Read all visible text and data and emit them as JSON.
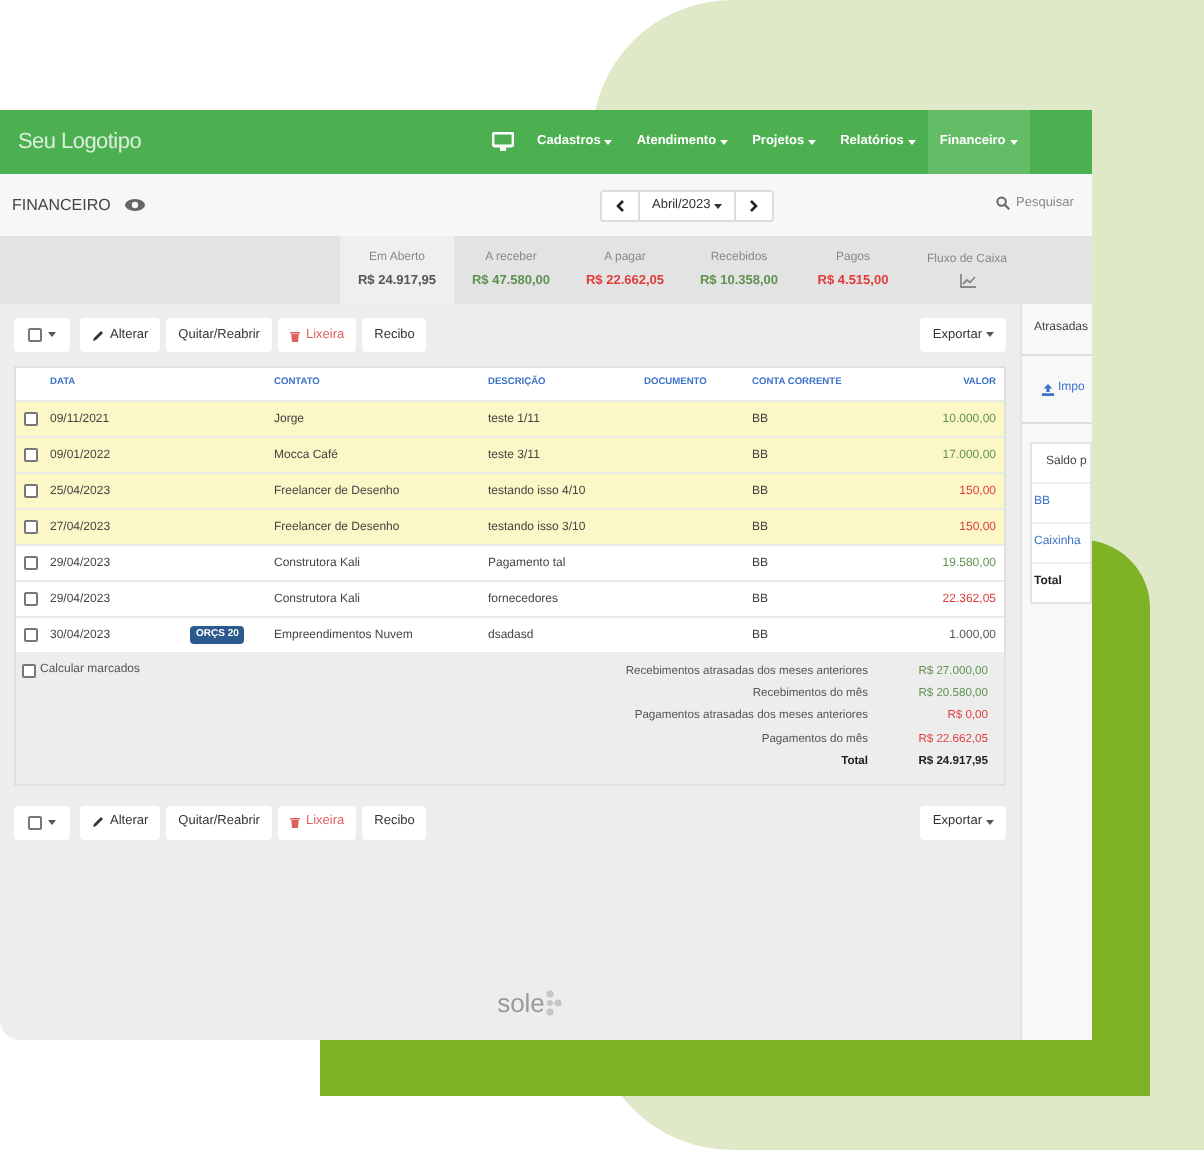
{
  "logo": "Seu Logotipo",
  "nav": [
    {
      "label": "Cadastros",
      "selected": false
    },
    {
      "label": "Atendimento",
      "selected": false
    },
    {
      "label": "Projetos",
      "selected": false
    },
    {
      "label": "Relatórios",
      "selected": false
    },
    {
      "label": "Financeiro",
      "selected": true
    }
  ],
  "page_title": "FINANCEIRO",
  "period": "Abril/2023",
  "search": {
    "placeholder": "Pesquisar"
  },
  "summary": [
    {
      "label": "Em Aberto",
      "value": "R$ 24.917,95",
      "color": "#555555",
      "selected": true
    },
    {
      "label": "A receber",
      "value": "R$ 47.580,00",
      "color": "#5f9150",
      "selected": false
    },
    {
      "label": "A pagar",
      "value": "R$ 22.662,05",
      "color": "#e03c3c",
      "selected": false
    },
    {
      "label": "Recebidos",
      "value": "R$ 10.358,00",
      "color": "#5f9150",
      "selected": false
    },
    {
      "label": "Pagos",
      "value": "R$ 4.515,00",
      "color": "#e03c3c",
      "selected": false
    },
    {
      "label": "Fluxo de Caixa",
      "kind": "chart",
      "selected": false
    }
  ],
  "toolbars": [
    {
      "buttons": [
        {
          "label": "Alterar",
          "kind": "edit"
        },
        {
          "label": "Quitar/Reabrir",
          "kind": "plain"
        },
        {
          "label": "Lixeira",
          "kind": "danger"
        },
        {
          "label": "Recibo",
          "kind": "plain"
        }
      ],
      "export": "Exportar"
    },
    {
      "buttons": [
        {
          "label": "Alterar",
          "kind": "edit"
        },
        {
          "label": "Quitar/Reabrir",
          "kind": "plain"
        },
        {
          "label": "Lixeira",
          "kind": "danger"
        },
        {
          "label": "Recibo",
          "kind": "plain"
        }
      ],
      "export": "Exportar"
    }
  ],
  "table": {
    "columns": [
      "DATA",
      "CONTATO",
      "DESCRIÇÃO",
      "DOCUMENTO",
      "CONTA CORRENTE",
      "VALOR"
    ],
    "rows": [
      {
        "date": "09/11/2021",
        "contact": "Jorge",
        "description": "teste 1/11",
        "account": "BB",
        "value": "10.000,00",
        "color": "#5f9150",
        "overdue": true,
        "checked": false
      },
      {
        "date": "09/01/2022",
        "contact": "Mocca Café",
        "description": "teste 3/11",
        "account": "BB",
        "value": "17.000,00",
        "color": "#5f9150",
        "overdue": true,
        "checked": false
      },
      {
        "date": "25/04/2023",
        "contact": "Freelancer de Desenho",
        "description": "testando isso 4/10",
        "account": "BB",
        "value": "150,00",
        "color": "#e03c3c",
        "overdue": true,
        "checked": false
      },
      {
        "date": "27/04/2023",
        "contact": "Freelancer de Desenho",
        "description": "testando isso 3/10",
        "account": "BB",
        "value": "150,00",
        "color": "#e03c3c",
        "overdue": true,
        "checked": false
      },
      {
        "date": "29/04/2023",
        "contact": "Construtora Kali",
        "description": "Pagamento tal",
        "account": "BB",
        "value": "19.580,00",
        "color": "#5f9150",
        "overdue": false,
        "checked": false
      },
      {
        "date": "29/04/2023",
        "contact": "Construtora Kali",
        "description": "fornecedores",
        "account": "BB",
        "value": "22.362,05",
        "color": "#e03c3c",
        "overdue": false,
        "checked": false
      },
      {
        "date": "30/04/2023",
        "badge": "ORÇS 20",
        "contact": "Empreendimentos Nuvem",
        "description": "dsadasd",
        "account": "BB",
        "value": "1.000,00",
        "color": "#555555",
        "overdue": false,
        "checked": false
      }
    ]
  },
  "calc_marked": {
    "label": "Calcular marcados",
    "checked": false
  },
  "totals": [
    {
      "label": "Recebimentos atrasadas dos meses anteriores",
      "value": "R$ 27.000,00",
      "color": "#5f9150",
      "kind": "line"
    },
    {
      "label": "Recebimentos do mês",
      "value": "R$ 20.580,00",
      "color": "#5f9150",
      "kind": "line"
    },
    {
      "label": "Pagamentos atrasadas dos meses anteriores",
      "value": "R$ 0,00",
      "color": "#e03c3c",
      "kind": "line"
    },
    {
      "label": "Pagamentos do mês",
      "value": "R$ 22.662,05",
      "color": "#e03c3c",
      "kind": "line"
    },
    {
      "label": "Total",
      "value": "R$ 24.917,95",
      "color": "#222222",
      "kind": "total"
    }
  ],
  "side_panel": {
    "tab": "Atrasadas",
    "import": "Impo",
    "card_title": "Saldo p",
    "accounts": [
      "BB",
      "Caixinha"
    ],
    "total": "Total"
  },
  "footer_logo": "sole"
}
